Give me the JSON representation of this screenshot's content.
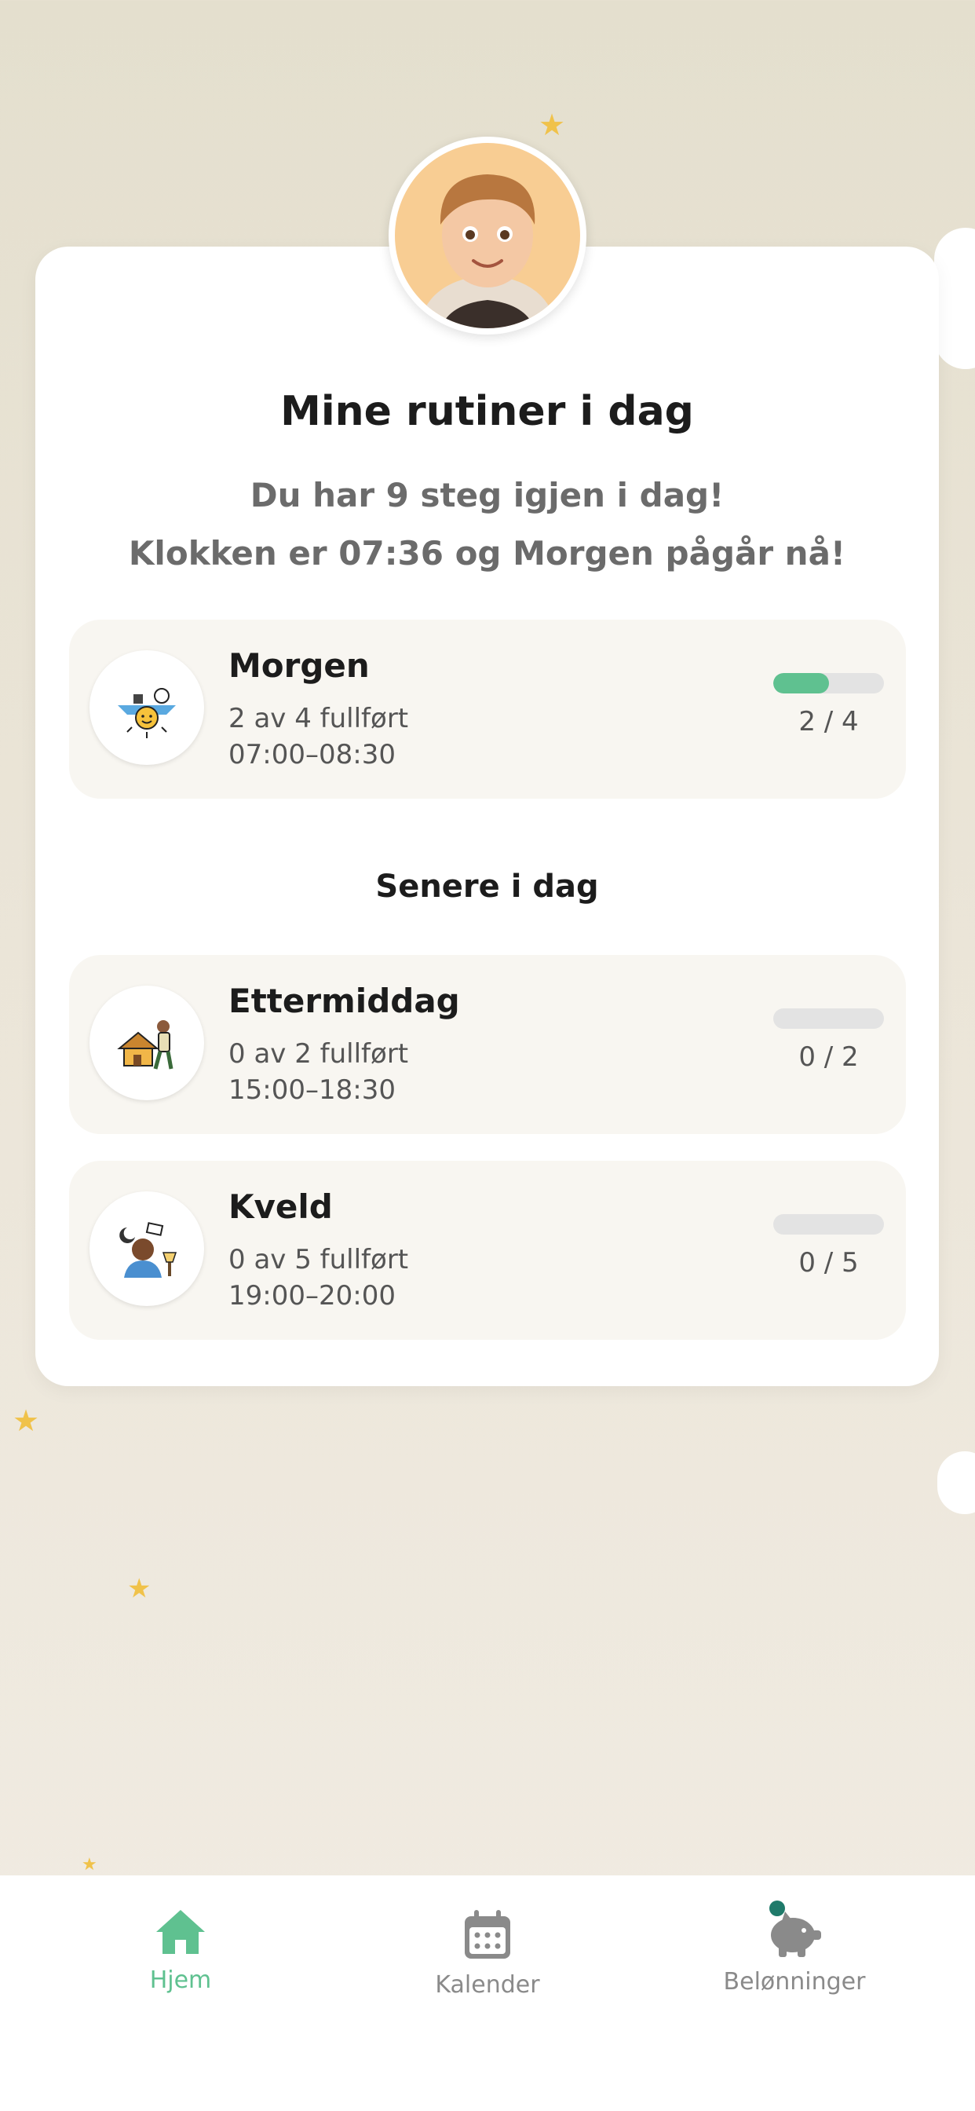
{
  "header": {
    "title": "Mine rutiner i dag",
    "steps_left": "Du har 9 steg igjen i dag!",
    "now_text": "Klokken er 07:36 og Morgen pågår nå!"
  },
  "colors": {
    "accent": "#5fc190",
    "star": "#f0c24a",
    "inactive": "#8a8a8a"
  },
  "current_routine": {
    "name": "Morgen",
    "progress_text": "2 av 4 fullført",
    "time": "07:00–08:30",
    "count": "2 / 4",
    "progress": 0.5,
    "icon": "morning-sun-icon"
  },
  "later_section": {
    "title": "Senere i dag"
  },
  "later_routines": [
    {
      "name": "Ettermiddag",
      "progress_text": "0 av 2 fullført",
      "time": "15:00–18:30",
      "count": "0 / 2",
      "progress": 0,
      "icon": "afternoon-house-icon"
    },
    {
      "name": "Kveld",
      "progress_text": "0 av 5 fullført",
      "time": "19:00–20:00",
      "count": "0 / 5",
      "progress": 0,
      "icon": "evening-moon-icon"
    }
  ],
  "nav": [
    {
      "label": "Hjem",
      "icon": "home-icon",
      "active": true
    },
    {
      "label": "Kalender",
      "icon": "calendar-icon",
      "active": false
    },
    {
      "label": "Belønninger",
      "icon": "piggy-bank-icon",
      "active": false
    }
  ]
}
